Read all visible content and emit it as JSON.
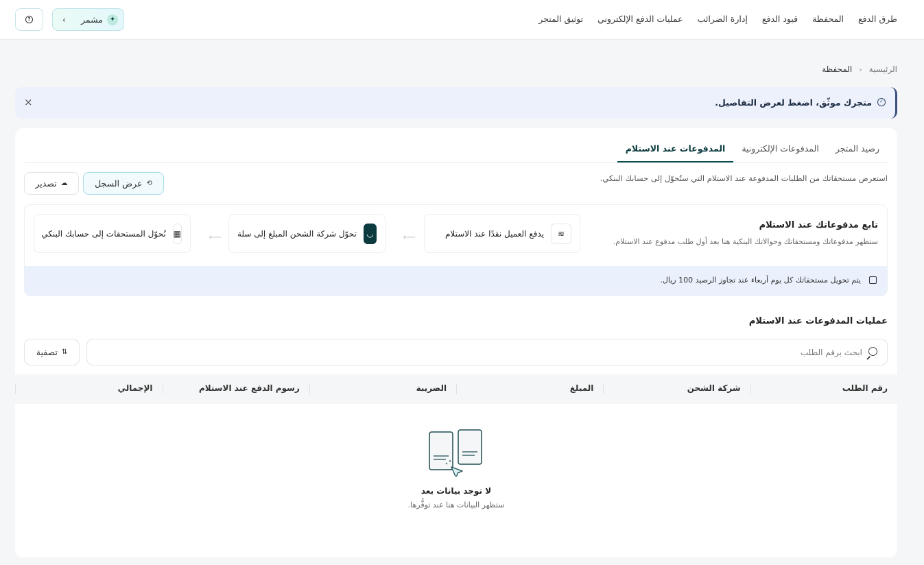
{
  "topnav": {
    "items": [
      "طرق الدفع",
      "المحفظة",
      "قيود الدفع",
      "إدارة الضرائب",
      "عمليات الدفع الإلكتروني",
      "توثيق المتجر"
    ]
  },
  "assistant": {
    "label": "مشمر"
  },
  "breadcrumb": {
    "home": "الرئيسية",
    "current": "المحفظة"
  },
  "banner": {
    "text": "متجرك موثّق، اضغط لعرض التفاصيل."
  },
  "tabs": [
    "رصيد المتجر",
    "المدفوعات الإلكترونية",
    "المدفوعات عند الاستلام"
  ],
  "active_tab_index": 2,
  "description": "استعرض مستحقاتك من الطلبات المدفوعة عند الاستلام التي ستُحوّل إلى حسابك البنكي.",
  "buttons": {
    "history": "عرض السجل",
    "export": "تصدير",
    "filter": "تصفية"
  },
  "tracking": {
    "title": "تابع مدفوعاتك عند الاستلام",
    "subtitle": "ستظهر مدفوعاتك ومستحقاتك وحوالاتك البنكية هنا بعد أول طلب مدفوع عند الاستلام.",
    "steps": [
      {
        "label": "يدفع العميل نقدًا عند الاستلام",
        "icon": "cash-icon"
      },
      {
        "label": "تحوّل شركة الشحن المبلغ إلى سلة",
        "icon": "salla-logo-icon"
      },
      {
        "label": "نُحوّل المستحقات إلى حسابك البنكي",
        "icon": "bank-icon"
      }
    ],
    "note": "يتم تحويل مستحقاتك كل يوم أربعاء عند تجاوز الرصيد 100 ريال."
  },
  "operations": {
    "title": "عمليات المدفوعات عند الاستلام",
    "search_placeholder": "ابحث برقم الطلب"
  },
  "table": {
    "columns": [
      "رقم الطلب",
      "شركة الشحن",
      "المبلغ",
      "الضريبة",
      "رسوم الدفع عند الاستلام",
      "الإجمالي"
    ]
  },
  "empty_state": {
    "title": "لا توجد بيانات بعد",
    "subtitle": "ستظهر البيانات هنا عند توفُّرها."
  },
  "colors": {
    "primary": "#0b3b3f",
    "banner_bg": "#edf1fb",
    "note_bg": "#eaf1fc",
    "accent_border": "#a9dbe4"
  }
}
